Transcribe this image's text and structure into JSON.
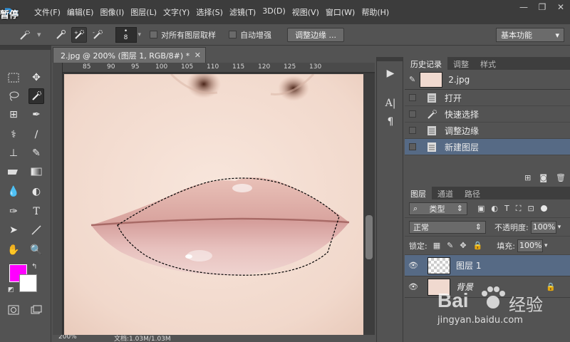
{
  "app": {
    "logo": "Ps"
  },
  "menu": [
    "文件(F)",
    "编辑(E)",
    "图像(I)",
    "图层(L)",
    "文字(Y)",
    "选择(S)",
    "滤镜(T)",
    "3D(D)",
    "视图(V)",
    "窗口(W)",
    "帮助(H)"
  ],
  "overlay_text": "暂停",
  "options": {
    "brush_size": "8",
    "sample_all_layers": "对所有图层取样",
    "auto_enhance": "自动增强",
    "refine_edge": "调整边缘 ...",
    "workspace": "基本功能"
  },
  "document": {
    "tab_title": "2.jpg @ 200% (图层 1, RGB/8#) *",
    "ruler_ticks": [
      "85",
      "90",
      "95",
      "100",
      "105",
      "110",
      "115",
      "120",
      "125",
      "130"
    ],
    "status_zoom": "200%",
    "status_doc": "文档:1.03M/1.03M"
  },
  "history": {
    "tabs": [
      "历史记录",
      "调整",
      "样式"
    ],
    "snapshot": "2.jpg",
    "items": [
      {
        "label": "打开",
        "selected": false
      },
      {
        "label": "快速选择",
        "selected": false
      },
      {
        "label": "调整边缘",
        "selected": false
      },
      {
        "label": "新建图层",
        "selected": true
      }
    ]
  },
  "layers": {
    "tabs": [
      "图层",
      "通道",
      "路径"
    ],
    "filter_kind": "类型",
    "blend_mode": "正常",
    "opacity_label": "不透明度:",
    "opacity_value": "100%",
    "lock_label": "锁定:",
    "fill_label": "填充:",
    "fill_value": "100%",
    "items": [
      {
        "name": "图层 1",
        "selected": true
      },
      {
        "name": "背景",
        "selected": false
      }
    ]
  },
  "watermark": {
    "brand": "Bai",
    "brand2": "经验",
    "url": "jingyan.baidu.com"
  },
  "colors": {
    "foreground": "#ff00ff",
    "background": "#ffffff",
    "selected_row": "#566a85",
    "accent": "#2fa3f7"
  }
}
